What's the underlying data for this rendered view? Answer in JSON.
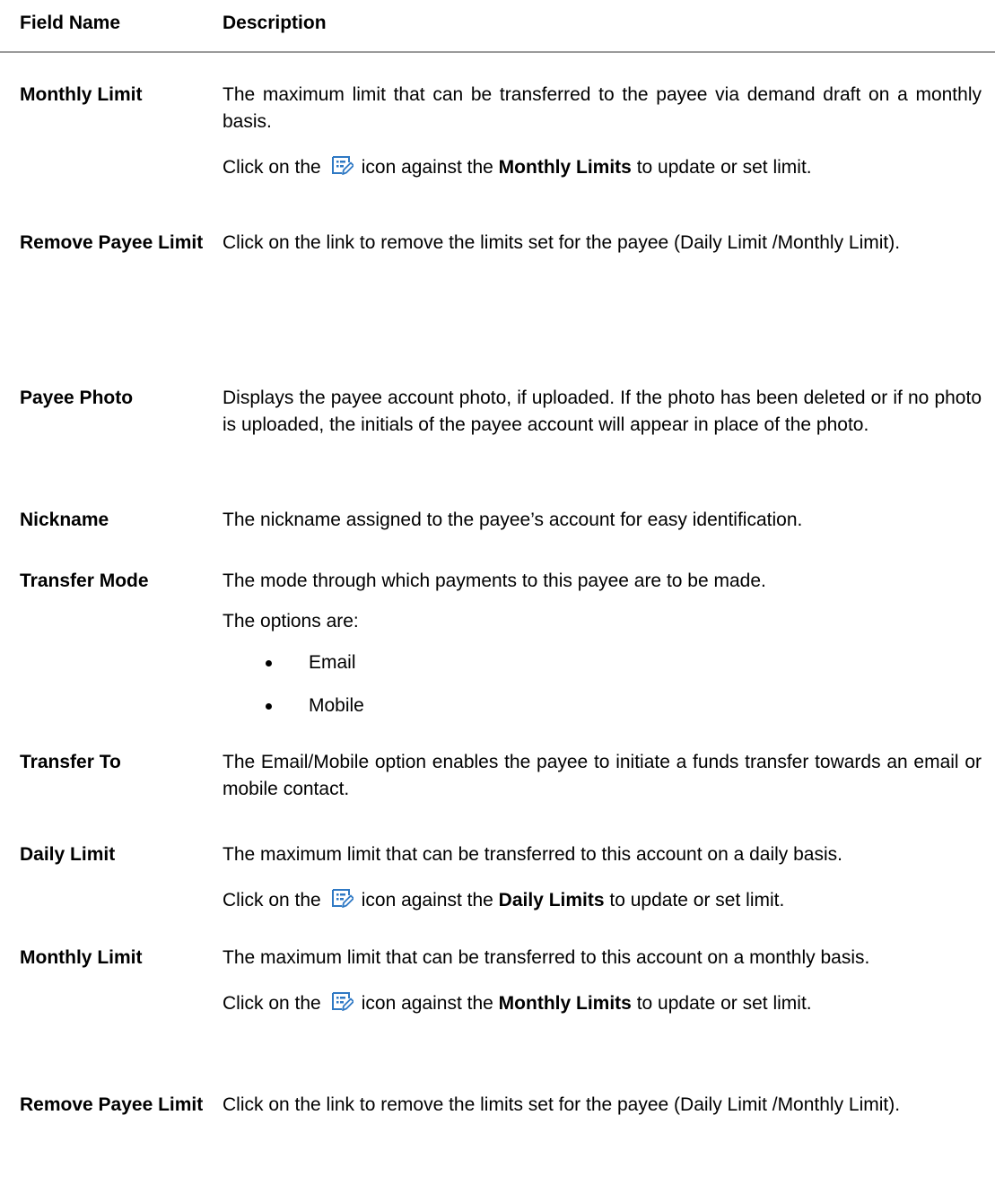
{
  "header": {
    "field_name": "Field Name",
    "description": "Description"
  },
  "rows": [
    {
      "field": "Monthly Limit",
      "desc": "The maximum limit that can be transferred to the payee via demand draft on a monthly basis.",
      "action": {
        "pre": "Click on the",
        "icon": "edit-limit-icon",
        "mid": "icon against the",
        "bold": "Monthly Limits",
        "post": "to update or set limit."
      }
    },
    {
      "field": "Remove Payee Limit",
      "desc": "Click on the link to remove the limits set for the payee (Daily Limit /Monthly Limit)."
    },
    {
      "field": "Payee Photo",
      "desc": "Displays the payee account photo, if uploaded. If the photo has been deleted or if no photo is uploaded, the initials of the payee account will appear in place of the photo."
    },
    {
      "field": "Nickname",
      "desc": "The nickname assigned to the payee’s account for easy identification."
    },
    {
      "field": "Transfer Mode",
      "desc": "The mode through which payments to this payee are to be made.",
      "options_label": "The options are:",
      "options": [
        "Email",
        "Mobile"
      ]
    },
    {
      "field": "Transfer To",
      "desc": "The Email/Mobile option enables the payee to initiate a funds transfer towards an email or mobile contact."
    },
    {
      "field": "Daily Limit",
      "desc": "The maximum limit that can be transferred to this account on a daily basis.",
      "action": {
        "pre": "Click on the",
        "icon": "edit-limit-icon",
        "mid": "icon against the",
        "bold": "Daily Limits",
        "post": "to update or set limit."
      }
    },
    {
      "field": "Monthly Limit",
      "desc": "The maximum limit that can be transferred to this account on a monthly basis.",
      "action": {
        "pre": "Click on the",
        "icon": "edit-limit-icon",
        "mid": "icon against the",
        "bold": "Monthly Limits",
        "post": "to update or set limit."
      }
    },
    {
      "field": "Remove Payee Limit",
      "desc": "Click on the link to remove the limits set for the payee (Daily Limit /Monthly Limit)."
    }
  ],
  "colors": {
    "icon_blue": "#2f79c4",
    "rule": "#9a9a9a"
  }
}
